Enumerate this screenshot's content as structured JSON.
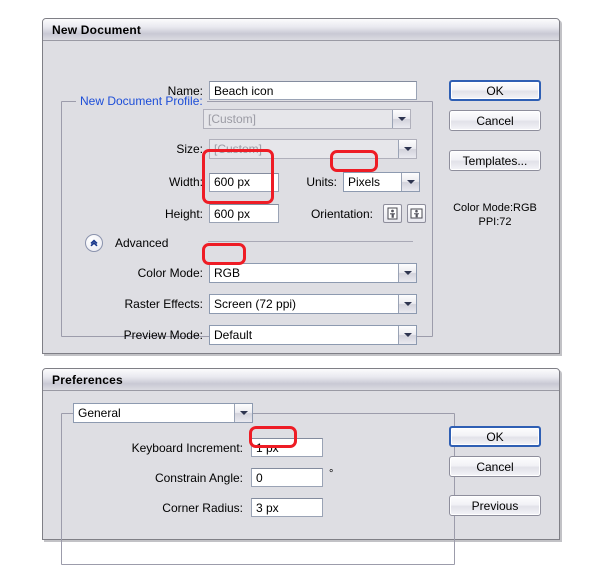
{
  "new_document": {
    "title": "New Document",
    "fields": {
      "name_label": "Name:",
      "name_value": "Beach icon",
      "profile_label": "New Document Profile:",
      "profile_value": "[Custom]",
      "size_label": "Size:",
      "size_value": "[Custom]",
      "width_label": "Width:",
      "width_value": "600 px",
      "height_label": "Height:",
      "height_value": "600 px",
      "units_label": "Units:",
      "units_value": "Pixels",
      "orientation_label": "Orientation:",
      "orientation_portrait_icon": "portrait-orientation-icon",
      "orientation_landscape_icon": "landscape-orientation-icon",
      "advanced_label": "Advanced",
      "advanced_toggle_icon": "chevron-up-double-icon",
      "color_mode_label": "Color Mode:",
      "color_mode_value": "RGB",
      "raster_effects_label": "Raster Effects:",
      "raster_effects_value": "Screen (72 ppi)",
      "preview_mode_label": "Preview Mode:",
      "preview_mode_value": "Default"
    },
    "buttons": {
      "ok": "OK",
      "cancel": "Cancel",
      "templates": "Templates..."
    },
    "info": {
      "color_mode": "Color Mode:RGB",
      "ppi": "PPI:72"
    }
  },
  "preferences": {
    "title": "Preferences",
    "category_value": "General",
    "fields": {
      "keyboard_increment_label": "Keyboard Increment:",
      "keyboard_increment_value": "1 px",
      "constrain_angle_label": "Constrain Angle:",
      "constrain_angle_value": "0",
      "constrain_angle_unit": "°",
      "corner_radius_label": "Corner Radius:",
      "corner_radius_value": "3 px"
    },
    "buttons": {
      "ok": "OK",
      "cancel": "Cancel",
      "previous": "Previous"
    }
  },
  "annotations": {
    "accent_color": "#ee1c25",
    "highlight_size": "size-fields-highlight",
    "highlight_units": "units-value-highlight",
    "highlight_color_mode": "color-mode-value-highlight",
    "highlight_keyboard_increment": "keyboard-increment-highlight"
  }
}
